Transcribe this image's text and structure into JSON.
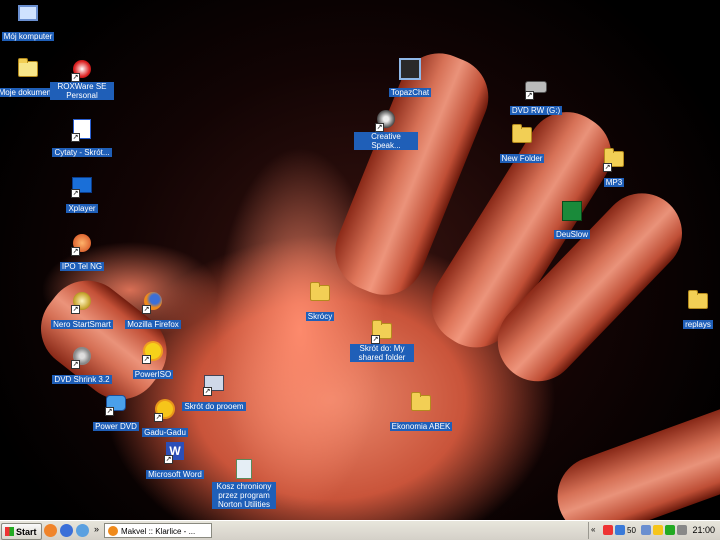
{
  "desktop": {
    "icons": [
      {
        "label": "Mój komputer",
        "glyph": "computer-icon"
      },
      {
        "label": "Moje dokumenty",
        "glyph": "documents-icon"
      },
      {
        "label": "ROXWare SE Personal",
        "glyph": "app-icon"
      },
      {
        "label": "Cytaty - Skrót...",
        "glyph": "document-icon"
      },
      {
        "label": "Xplayer",
        "glyph": "player-icon"
      },
      {
        "label": "IPO Tel NG",
        "glyph": "phone-icon"
      },
      {
        "label": "Nero StartSmart",
        "glyph": "nero-icon"
      },
      {
        "label": "Mozilla Firefox",
        "glyph": "firefox-icon"
      },
      {
        "label": "Power DVD",
        "glyph": "dvd-icon"
      },
      {
        "label": "DVD Shrink 3.2",
        "glyph": "disc-icon"
      },
      {
        "label": "Gadu-Gadu",
        "glyph": "sun-icon"
      },
      {
        "label": "PowerISO",
        "glyph": "sun-icon"
      },
      {
        "label": "Skrót do prooem",
        "glyph": "network-icon"
      },
      {
        "label": "Microsoft Word",
        "glyph": "word-icon"
      },
      {
        "label": "Kosz chroniony przez program Norton Utilities",
        "glyph": "recycle-icon"
      },
      {
        "label": "TopazChat",
        "glyph": "chat-icon"
      },
      {
        "label": "Creative Speak...",
        "glyph": "speaker-icon"
      },
      {
        "label": "DVD RW (G:)",
        "glyph": "drive-icon"
      },
      {
        "label": "New Folder",
        "glyph": "folder-icon"
      },
      {
        "label": "MP3",
        "glyph": "folder-icon"
      },
      {
        "label": "DeuSlow",
        "glyph": "book-icon"
      },
      {
        "label": "Skrócy",
        "glyph": "folder-icon"
      },
      {
        "label": "Skrót do: My shared folder",
        "glyph": "folder-icon"
      },
      {
        "label": "Ekonomia ABEK",
        "glyph": "folder-icon"
      },
      {
        "label": "replays",
        "glyph": "folder-icon"
      }
    ]
  },
  "taskbar": {
    "start_label": "Start",
    "task_label": "Makvel :: Klarlice - ...",
    "clock": "21:00",
    "tray_volume": "50"
  },
  "colors": {
    "label_bg": "#1f5fb8",
    "taskbar": "#d4d0c8"
  }
}
